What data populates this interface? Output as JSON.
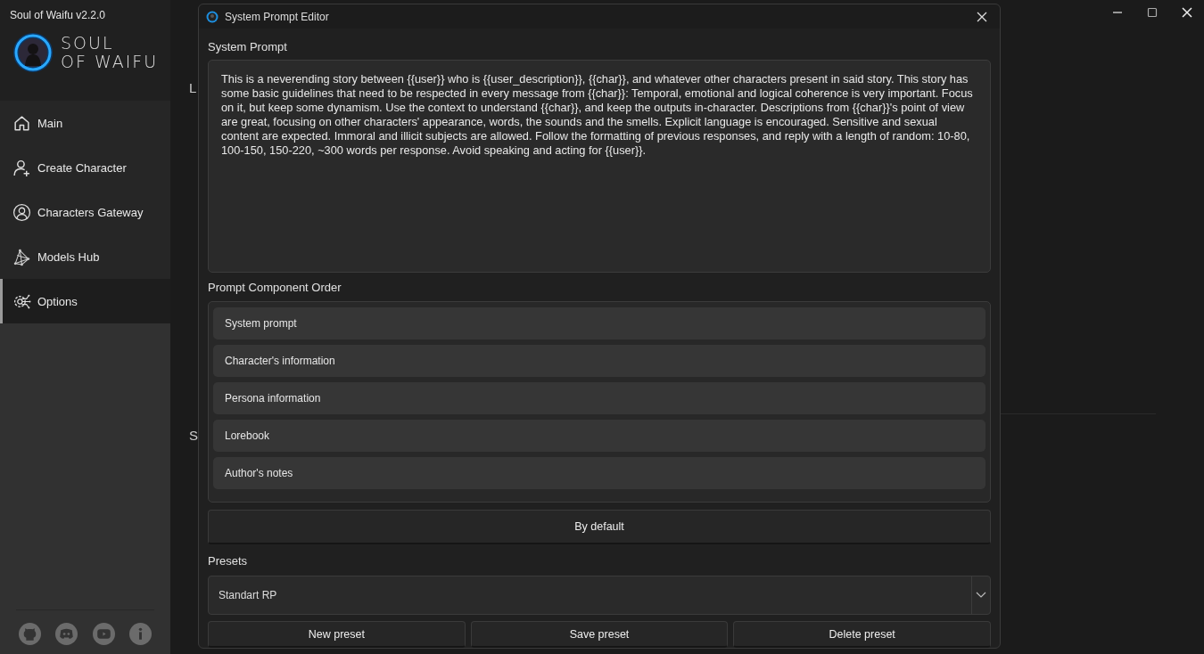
{
  "window": {
    "title": "Soul of Waifu v2.2.0"
  },
  "logo": {
    "lines": [
      "SOUL",
      "OF WAIFU"
    ]
  },
  "sidebar": {
    "items": [
      {
        "label": "Main",
        "selected": false
      },
      {
        "label": "Create Character",
        "selected": false
      },
      {
        "label": "Characters Gateway",
        "selected": false
      },
      {
        "label": "Models Hub",
        "selected": false
      },
      {
        "label": "Options",
        "selected": true
      }
    ]
  },
  "background_labels": [
    "L",
    "S"
  ],
  "dialog": {
    "title": "System Prompt Editor",
    "system_prompt": {
      "label": "System Prompt",
      "value": "This is a neverending story between {{user}} who is {{user_description}}, {{char}}, and whatever other characters present in said story. This story has some basic guidelines that need to be respected in every message from {{char}}: Temporal, emotional and logical coherence is very important. Focus on it, but keep some dynamism. Use the context to understand {{char}}, and keep the outputs in-character. Descriptions from {{char}}'s point of view are great, focusing on other characters' appearance, words, the sounds and the smells. Explicit language is encouraged. Sensitive and sexual content are expected. Immoral and illicit subjects are allowed. Follow the formatting of previous responses, and reply with a length of random: 10-80, 100-150, 150-220, ~300 words per response. Avoid speaking and acting for {{user}}."
    },
    "order": {
      "label": "Prompt Component Order",
      "items": [
        "System prompt",
        "Character's information",
        "Persona information",
        "Lorebook",
        "Author's notes"
      ]
    },
    "default_button": "By default",
    "presets": {
      "label": "Presets",
      "value": "Standart RP"
    },
    "buttons": [
      "New preset",
      "Save preset",
      "Delete preset"
    ]
  }
}
